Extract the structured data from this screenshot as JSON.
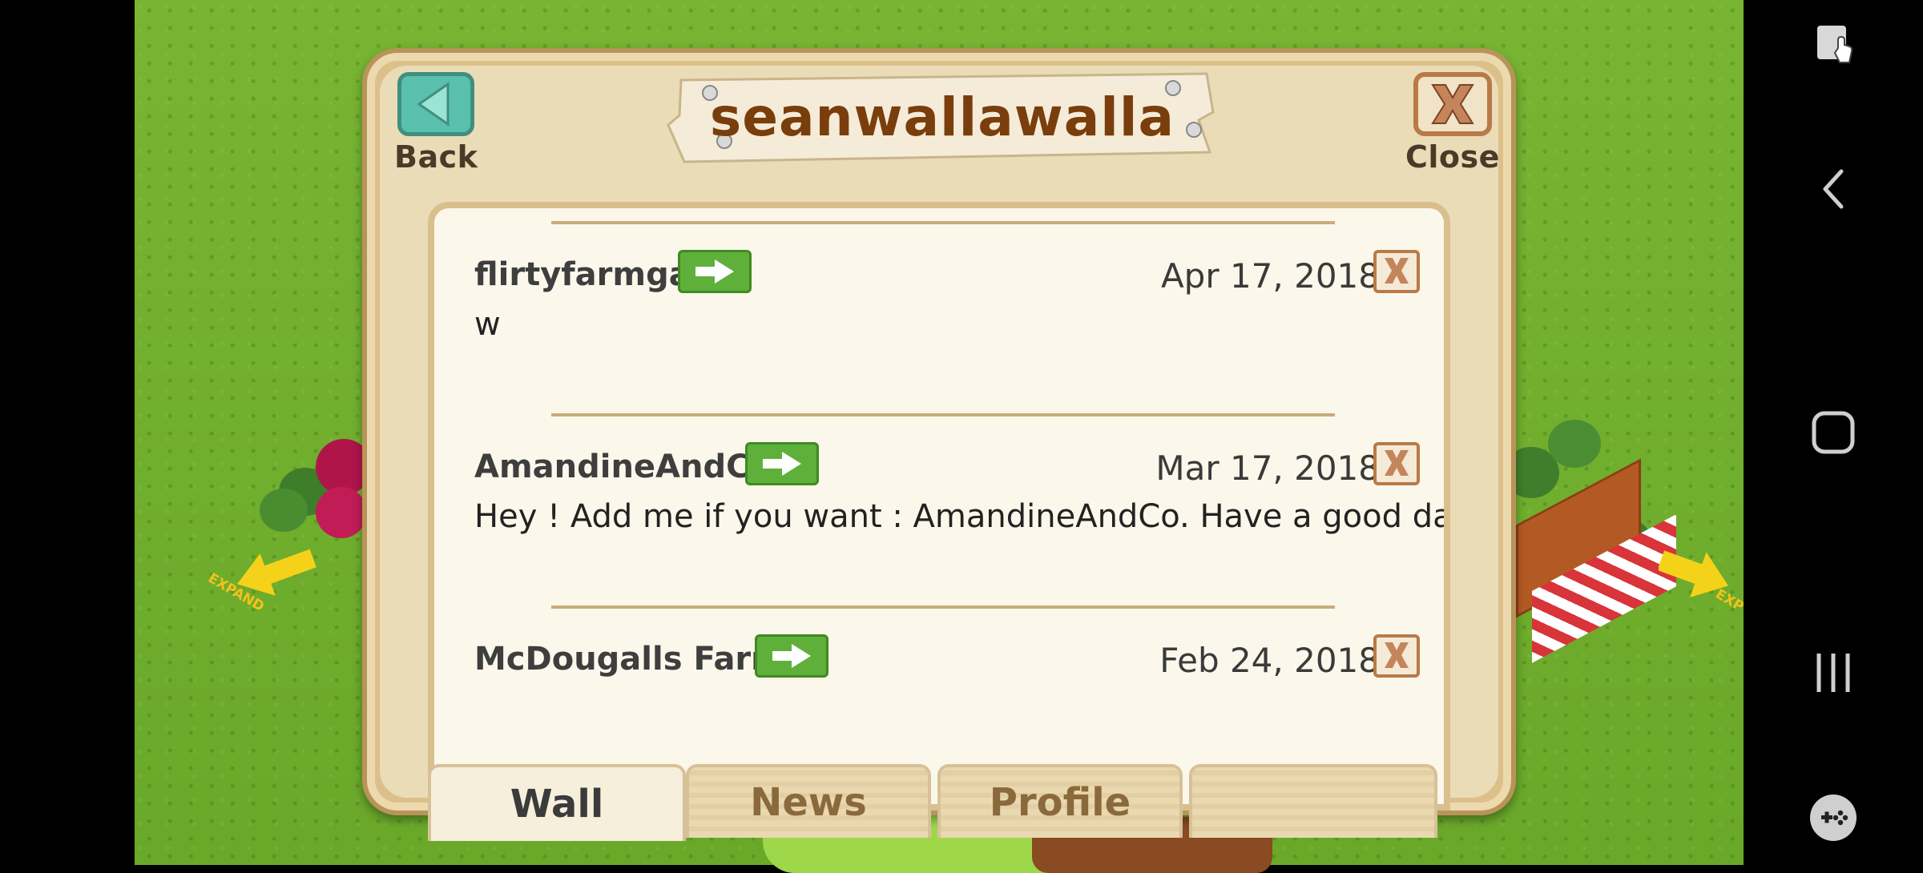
{
  "dialog": {
    "title": "seanwallawalla",
    "back_label": "Back",
    "close_label": "Close"
  },
  "posts": [
    {
      "author": "flirtyfarmgal",
      "date": "Apr 17, 2018",
      "message": "w"
    },
    {
      "author": "AmandineAndCo",
      "date": "Mar 17, 2018",
      "message": "Hey ! Add me if you want : AmandineAndCo. Have a good day !"
    },
    {
      "author": "McDougalls Farm",
      "date": "Feb 24, 2018",
      "message": ""
    }
  ],
  "tabs": [
    {
      "label": "Wall",
      "active": true
    },
    {
      "label": "News",
      "active": false
    },
    {
      "label": "Profile",
      "active": false
    },
    {
      "label": "",
      "active": false
    }
  ],
  "scene": {
    "expand_label": "EXPAND",
    "expand_label_right": "EXP"
  },
  "icons": [
    "teal-back-icon",
    "close-x-icon",
    "arrow-right-icon",
    "delete-x-icon",
    "screen-pin-icon",
    "nav-back-icon",
    "nav-home-icon",
    "nav-recents-icon",
    "game-controller-icon"
  ],
  "colors": {
    "grass": "#6aa82a",
    "panel": "#eadcb7",
    "title": "#7a3d0c",
    "go_green": "#5fb03a",
    "close_brown": "#b97a47"
  }
}
